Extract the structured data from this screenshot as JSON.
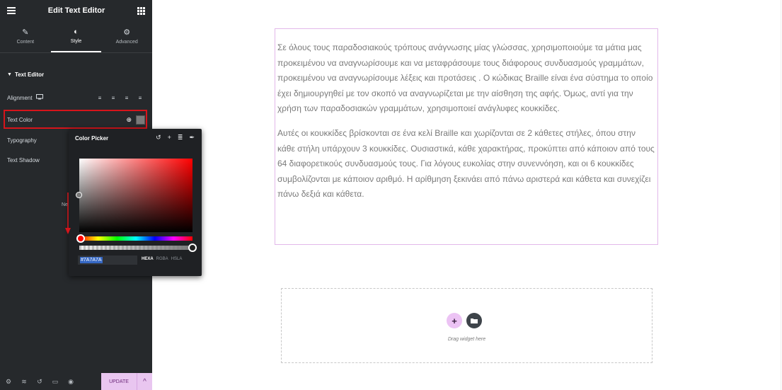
{
  "sidebar": {
    "title": "Edit Text Editor",
    "tabs": [
      {
        "label": "Content",
        "icon": "pencil-icon"
      },
      {
        "label": "Style",
        "icon": "half-circle-icon"
      },
      {
        "label": "Advanced",
        "icon": "gear-icon"
      }
    ],
    "active_tab": "Style",
    "section_title": "Text Editor",
    "alignment_label": "Alignment",
    "text_color_label": "Text Color",
    "text_color_value": "#7A7A7A",
    "typography_label": "Typography",
    "text_shadow_label": "Text Shadow",
    "obscured_text": "Ne",
    "update_label": "UPDATE"
  },
  "picker": {
    "title": "Color Picker",
    "hex_value": "#7A7A7A",
    "formats": [
      "HEXA",
      "RGBA",
      "HSLA"
    ],
    "selected_format": "HEXA"
  },
  "canvas": {
    "paragraphs": [
      "Σε όλους τους παραδοσιακούς τρόπους ανάγνωσης μίας γλώσσας, χρησιμοποιούμε τα μάτια μας προκειμένου να αναγνωρίσουμε και να μεταφράσουμε τους διάφορους συνδυασμούς γραμμάτων, προκειμένου να αναγνωρίσουμε λέξεις και προτάσεις . Ο κώδικας Braille είναι ένα σύστημα το οποίο έχει δημιουργηθεί με τον σκοπό να αναγνωρίζεται με την αίσθηση της αφής. Όμως, αντί για την χρήση των παραδοσιακών γραμμάτων, χρησιμοποιεί ανάγλυφες κουκκίδες.",
      "Αυτές οι κουκκίδες βρίσκονται σε ένα κελί Braille και χωρίζονται σε 2 κάθετες στήλες, όπου στην κάθε στήλη υπάρχουν 3 κουκκίδες. Ουσιαστικά, κάθε χαρακτήρας, προκύπτει από κάποιον από τους 64 διαφορετικούς συνδυασμούς τους. Για λόγους ευκολίας στην συνεννόηση, και οι 6 κουκκίδες συμβολίζονται με κάποιον αριθμό. Η αρίθμηση ξεκινάει από πάνω αριστερά και κάθετα και συνεχίζει πάνω δεξιά και κάθετα."
    ],
    "drop_text": "Drag widget here"
  },
  "colors": {
    "sidebar_bg": "#26292c",
    "highlight": "#d6141b",
    "accent": "#e9c6f0",
    "text_gray": "#7a7a7a"
  }
}
